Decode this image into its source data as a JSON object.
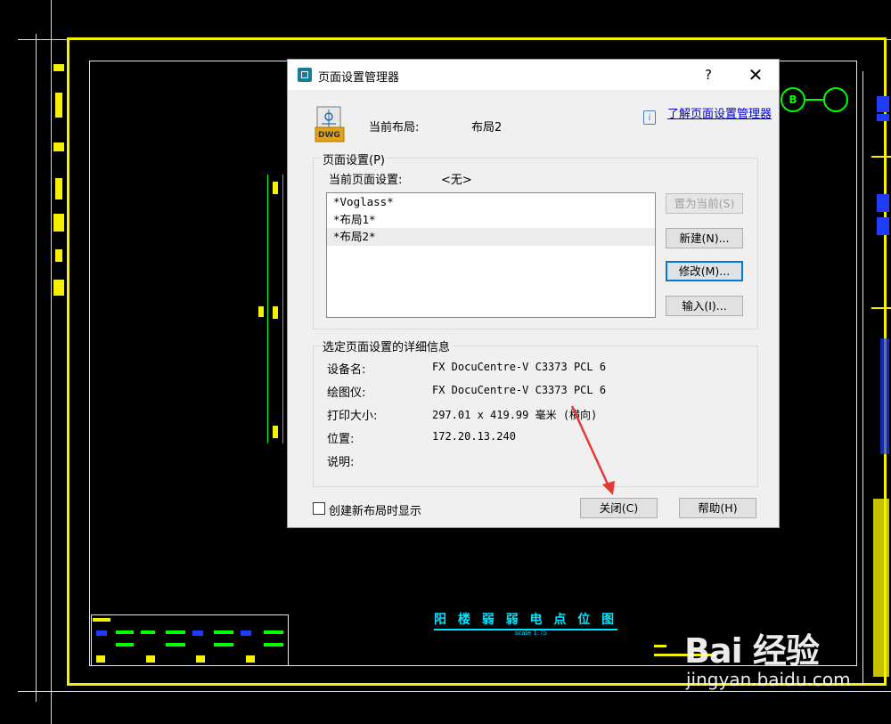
{
  "dialog": {
    "title": "页面设置管理器",
    "help_glyph": "?",
    "close_glyph": "✕",
    "current_layout_label": "当前布局:",
    "current_layout_value": "布局2",
    "dwg_icon_text": "DWG",
    "learn_link": "了解页面设置管理器",
    "info_glyph": "i",
    "page_setup_group": "页面设置(P)",
    "current_page_setup_label": "当前页面设置:",
    "current_page_setup_value": "<无>",
    "page_setups": [
      "*Voglass*",
      "*布局1*",
      "*布局2*"
    ],
    "selected_index": 2,
    "buttons": {
      "set_current": "置为当前(S)",
      "new": "新建(N)...",
      "modify": "修改(M)...",
      "import": "输入(I)...",
      "close": "关闭(C)",
      "help": "帮助(H)"
    },
    "details_group": "选定页面设置的详细信息",
    "details": [
      {
        "key": "设备名:",
        "value": "FX DocuCentre-V C3373 PCL 6"
      },
      {
        "key": "绘图仪:",
        "value": "FX DocuCentre-V C3373 PCL 6"
      },
      {
        "key": "打印大小:",
        "value": "297.01 x 419.99 毫米 (横向)"
      },
      {
        "key": "位置:",
        "value": "172.20.13.240"
      },
      {
        "key": "说明:",
        "value": ""
      }
    ],
    "show_on_new_layout_label": "创建新布局时显示",
    "show_on_new_layout_checked": false
  },
  "cad": {
    "drawing_title": "阳 楼 弱 弱 电 点 位 图",
    "scale_text": "scale 1:75"
  },
  "watermark": {
    "logo": "Bai  经验",
    "url": "jingyan.baidu.com"
  },
  "colors": {
    "cad_frame": "#f5f000",
    "cad_green": "#00ff00",
    "cad_cyan": "#00e5ff",
    "annotation_arrow": "#e53935",
    "focus_blue": "#0078d7",
    "link_blue": "#0000cc"
  }
}
